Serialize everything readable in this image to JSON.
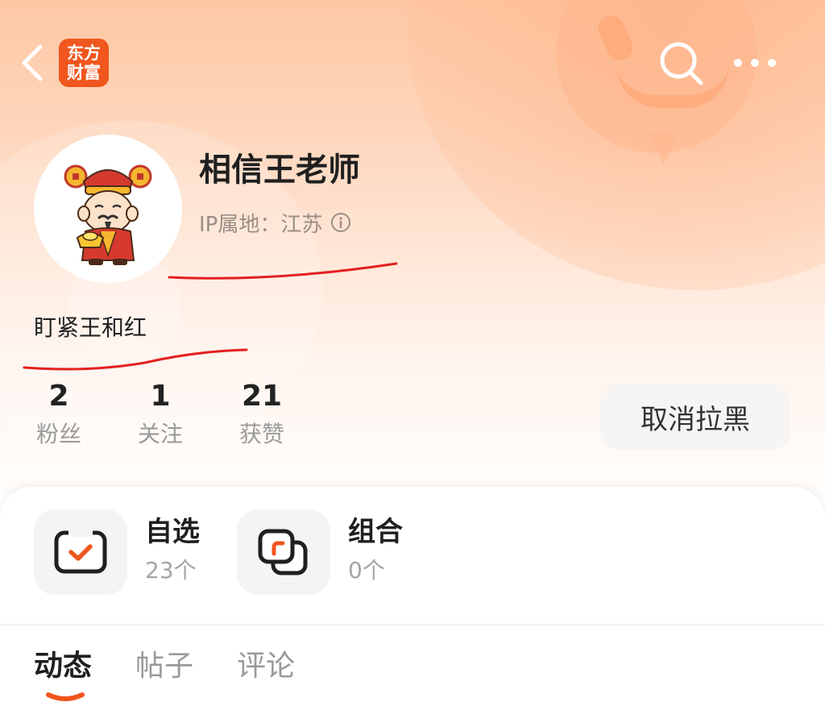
{
  "header": {
    "logo_line1": "东方",
    "logo_line2": "财富",
    "colors": {
      "accent": "#f0561d",
      "header_bg": "#fdc7a3"
    },
    "icons": {
      "back": "chevron-left-icon",
      "search": "search-icon",
      "more": "more-dots-icon"
    }
  },
  "profile": {
    "username": "相信王老师",
    "ip_location": "IP属地：江苏",
    "bio": "盯紧王和红"
  },
  "stats": [
    {
      "value": "2",
      "label": "粉丝"
    },
    {
      "value": "1",
      "label": "关注"
    },
    {
      "value": "21",
      "label": "获赞"
    }
  ],
  "actions": {
    "unblock_label": "取消拉黑"
  },
  "features": [
    {
      "title": "自选",
      "count": "23个",
      "icon": "checkbox-icon"
    },
    {
      "title": "组合",
      "count": "0个",
      "icon": "portfolio-icon"
    }
  ],
  "tabs": [
    {
      "label": "动态",
      "active": true
    },
    {
      "label": "帖子",
      "active": false
    },
    {
      "label": "评论",
      "active": false
    }
  ]
}
